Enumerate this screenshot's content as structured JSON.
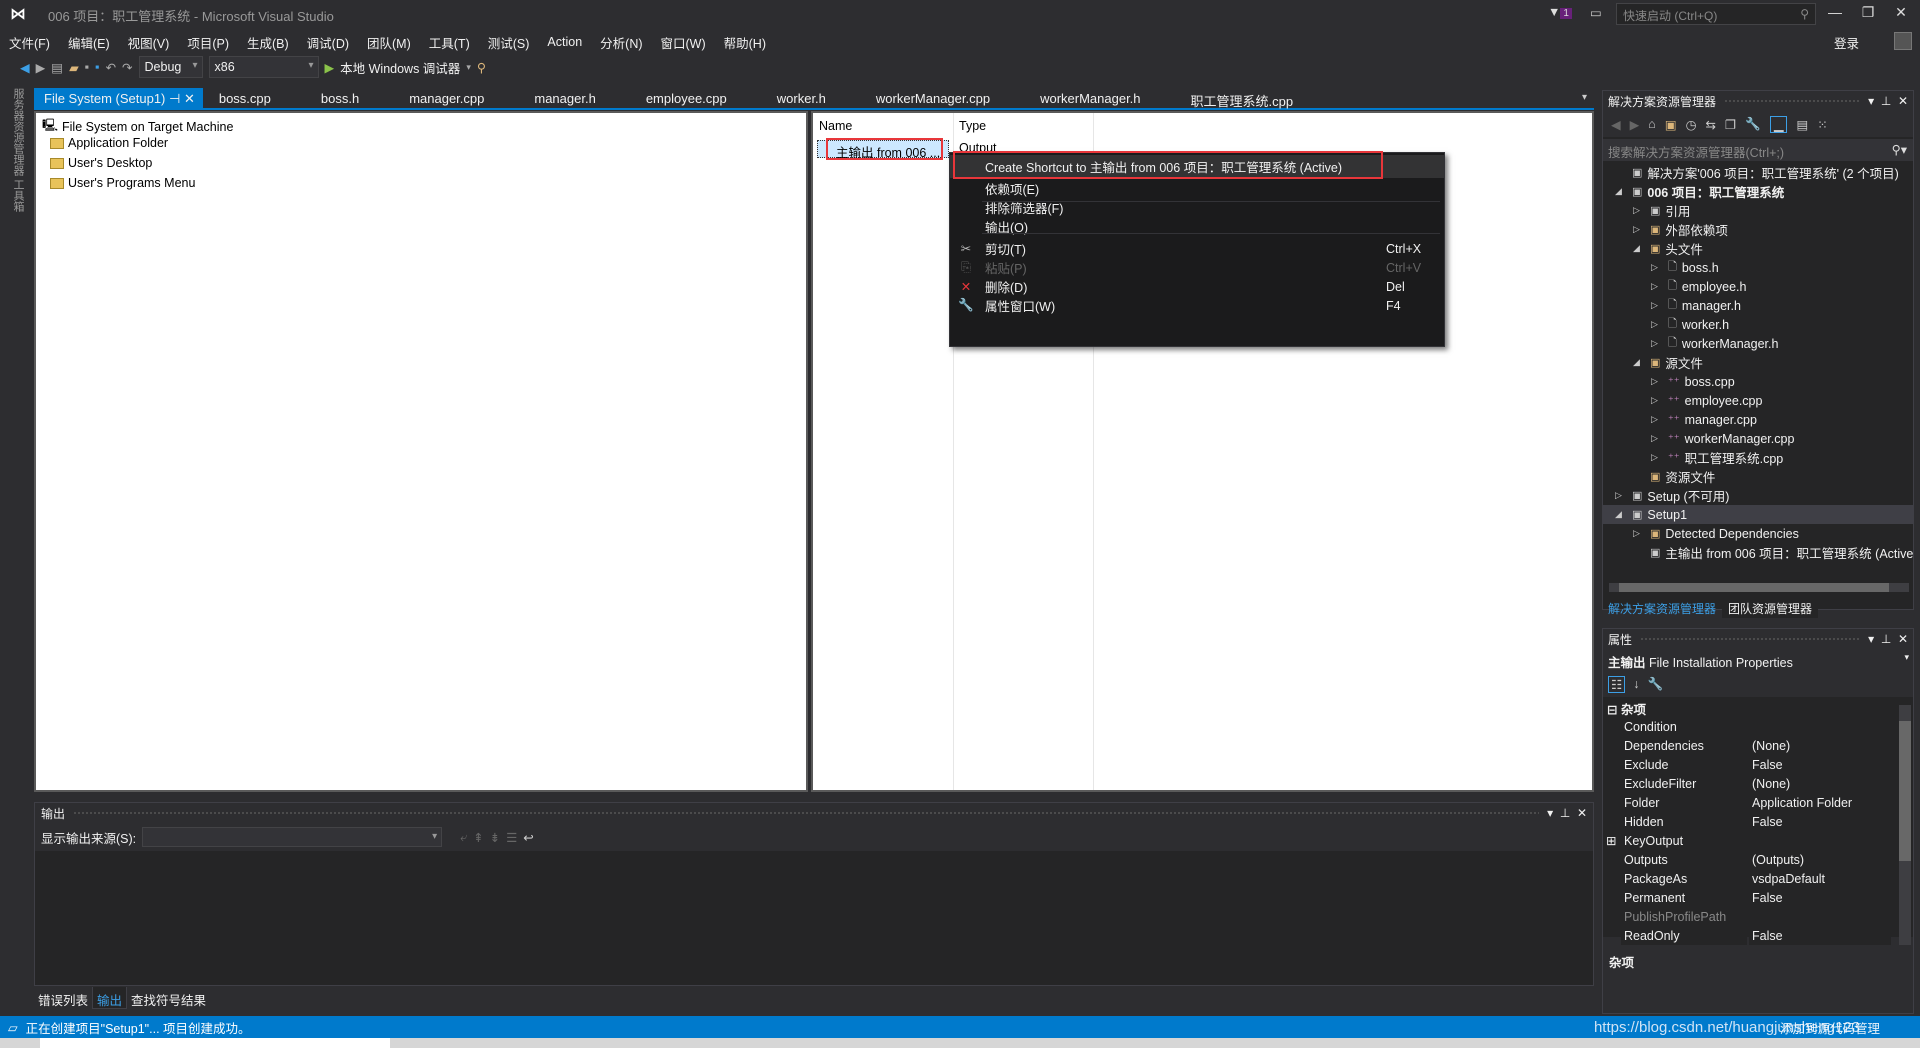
{
  "window": {
    "title": "006 项目：职工管理系统 - Microsoft Visual Studio",
    "quick_launch_placeholder": "快速启动 (Ctrl+Q)",
    "sign_in": "登录",
    "notification_count": "1"
  },
  "menu": [
    "文件(F)",
    "编辑(E)",
    "视图(V)",
    "项目(P)",
    "生成(B)",
    "调试(D)",
    "团队(M)",
    "工具(T)",
    "测试(S)",
    "Action",
    "分析(N)",
    "窗口(W)",
    "帮助(H)"
  ],
  "toolbar": {
    "config": "Debug",
    "platform": "x86",
    "run_label": "本地 Windows 调试器"
  },
  "left_strip": "服务器资源管理器  工具箱",
  "tabs": [
    {
      "label": "File System (Setup1)",
      "active": true
    },
    {
      "label": "boss.cpp"
    },
    {
      "label": "boss.h"
    },
    {
      "label": "manager.cpp"
    },
    {
      "label": "manager.h"
    },
    {
      "label": "employee.cpp"
    },
    {
      "label": "worker.h"
    },
    {
      "label": "workerManager.cpp"
    },
    {
      "label": "workerManager.h"
    },
    {
      "label": "职工管理系统.cpp"
    }
  ],
  "filesystem": {
    "root": "File System on Target Machine",
    "folders": [
      "Application Folder",
      "User's Desktop",
      "User's Programs Menu"
    ]
  },
  "detail": {
    "columns": [
      "Name",
      "Type"
    ],
    "row": {
      "name": "主输出 from 006 ...",
      "type": "Output"
    }
  },
  "context_menu": {
    "items": [
      {
        "label": "Create Shortcut to 主输出 from 006 项目：职工管理系统 (Active)",
        "highlighted": true
      },
      {
        "label": "依赖项(E)"
      },
      {
        "label": "排除筛选器(F)"
      },
      {
        "label": "输出(O)"
      },
      {
        "label": "剪切(T)",
        "shortcut": "Ctrl+X",
        "icon": "scissors"
      },
      {
        "label": "粘贴(P)",
        "shortcut": "Ctrl+V",
        "icon": "paste",
        "disabled": true
      },
      {
        "label": "删除(D)",
        "shortcut": "Del",
        "icon": "delete"
      },
      {
        "label": "属性窗口(W)",
        "shortcut": "F4",
        "icon": "wrench"
      }
    ]
  },
  "output": {
    "title": "输出",
    "source_label": "显示输出来源(S):",
    "source_value": "",
    "tabs": [
      "错误列表",
      "输出",
      "查找符号结果"
    ],
    "active_tab": "输出"
  },
  "solution_explorer": {
    "title": "解决方案资源管理器",
    "search_placeholder": "搜索解决方案资源管理器(Ctrl+;)",
    "items": [
      {
        "label": "解决方案'006 项目：职工管理系统' (2 个项目)",
        "level": 0,
        "expander": ""
      },
      {
        "label": "006 项目：职工管理系统",
        "level": 0,
        "expander": "open",
        "bold": true
      },
      {
        "label": "引用",
        "level": 1,
        "expander": "closed"
      },
      {
        "label": "外部依赖项",
        "level": 1,
        "expander": "closed"
      },
      {
        "label": "头文件",
        "level": 1,
        "expander": "open"
      },
      {
        "label": "boss.h",
        "level": 2,
        "expander": "closed"
      },
      {
        "label": "employee.h",
        "level": 2,
        "expander": "closed"
      },
      {
        "label": "manager.h",
        "level": 2,
        "expander": "closed"
      },
      {
        "label": "worker.h",
        "level": 2,
        "expander": "closed"
      },
      {
        "label": "workerManager.h",
        "level": 2,
        "expander": "closed"
      },
      {
        "label": "源文件",
        "level": 1,
        "expander": "open"
      },
      {
        "label": "boss.cpp",
        "level": 2,
        "expander": "closed"
      },
      {
        "label": "employee.cpp",
        "level": 2,
        "expander": "closed"
      },
      {
        "label": "manager.cpp",
        "level": 2,
        "expander": "closed"
      },
      {
        "label": "workerManager.cpp",
        "level": 2,
        "expander": "closed"
      },
      {
        "label": "职工管理系统.cpp",
        "level": 2,
        "expander": "closed"
      },
      {
        "label": "资源文件",
        "level": 1,
        "expander": ""
      },
      {
        "label": "Setup (不可用)",
        "level": 0,
        "expander": "closed"
      },
      {
        "label": "Setup1",
        "level": 0,
        "expander": "open",
        "selected": true
      },
      {
        "label": "Detected Dependencies",
        "level": 1,
        "expander": "closed"
      },
      {
        "label": "主输出 from 006 项目：职工管理系统 (Active)",
        "level": 1,
        "expander": ""
      }
    ],
    "bottom_tabs": [
      "解决方案资源管理器",
      "团队资源管理器"
    ]
  },
  "properties": {
    "title": "属性",
    "object_name": "主输出",
    "object_type": "File Installation Properties",
    "category": "杂项",
    "rows": [
      [
        "Condition",
        ""
      ],
      [
        "Dependencies",
        "(None)"
      ],
      [
        "Exclude",
        "False"
      ],
      [
        "ExcludeFilter",
        "(None)"
      ],
      [
        "Folder",
        "Application Folder"
      ],
      [
        "Hidden",
        "False"
      ],
      [
        "KeyOutput",
        ""
      ],
      [
        "Outputs",
        "(Outputs)"
      ],
      [
        "PackageAs",
        "vsdpaDefault"
      ],
      [
        "Permanent",
        "False"
      ],
      [
        "PublishProfilePath",
        ""
      ],
      [
        "ReadOnly",
        "False"
      ]
    ],
    "description": "杂项"
  },
  "status": {
    "text": "正在创建项目\"Setup1\"... 项目创建成功。",
    "right": "添加到源代码管理",
    "watermark": "https://blog.csdn.net/huangjunsheng123"
  },
  "colors": {
    "accent": "#007acc",
    "highlight_box": "#e8363a",
    "background": "#2d2d30"
  }
}
